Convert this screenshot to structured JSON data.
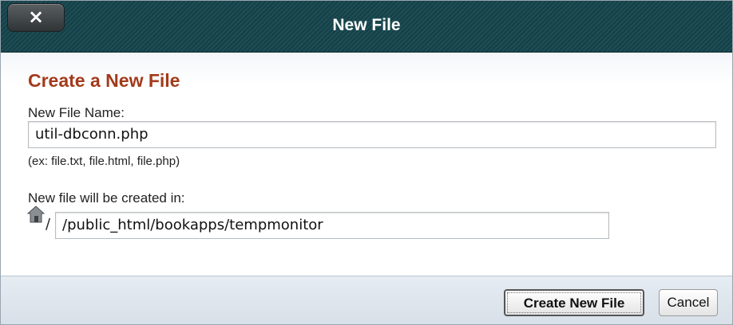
{
  "dialog": {
    "title": "New File",
    "close_label": "×"
  },
  "form": {
    "heading": "Create a New File",
    "file_name_label": "New File Name:",
    "file_name_value": "util-dbconn.php",
    "hint": "(ex: file.txt, file.html, file.php)",
    "location_label": "New file will be created in:",
    "path_prefix": "/",
    "path_value": "/public_html/bookapps/tempmonitor",
    "home_icon": "home-icon"
  },
  "buttons": {
    "create_label": "Create New File",
    "cancel_label": "Cancel"
  }
}
